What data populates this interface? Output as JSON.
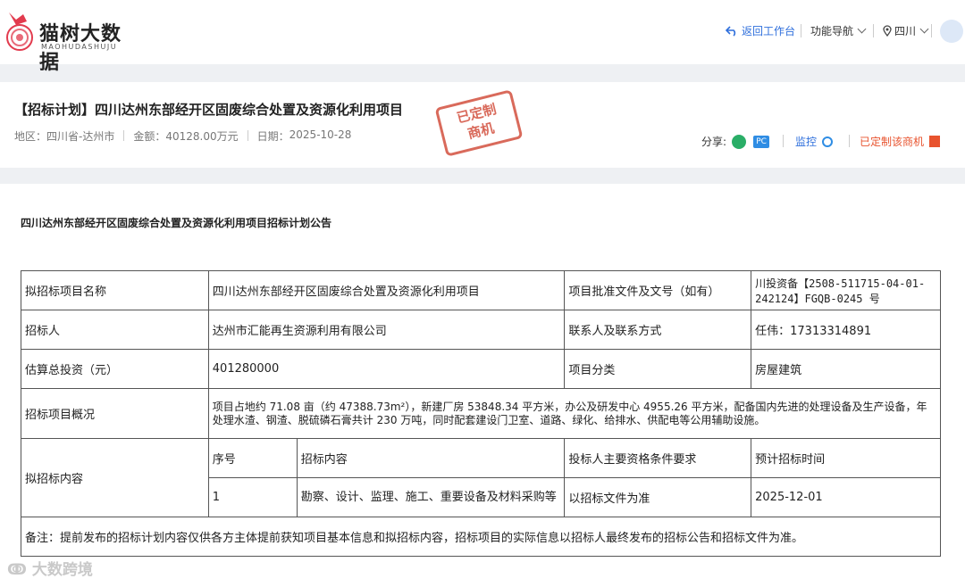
{
  "header": {
    "logo_text": "猫树大数据",
    "logo_sub": "MAOHUDASHUJU",
    "return_label": "返回工作台",
    "func_nav_label": "功能导航",
    "region_label": "四川"
  },
  "project": {
    "title": "【招标计划】四川达州东部经开区固废综合处置及资源化利用项目",
    "region_label": "地区：",
    "region_value": "四川省-达州市",
    "amount_label": "金额：",
    "amount_value": "40128.00万元",
    "date_label": "日期：",
    "date_value": "2025-10-28",
    "stamp_text_1": "已定制",
    "stamp_text_2": "商机"
  },
  "actions": {
    "share_label": "分享:",
    "pc_label": "PC",
    "monitor_label": "监控",
    "custom_label": "已定制该商机"
  },
  "notice": {
    "title": "四川达州东部经开区固废综合处置及资源化利用项目招标计划公告"
  },
  "table": {
    "r1_label": "拟招标项目名称",
    "r1_value": "四川达州东部经开区固废综合处置及资源化利用项目",
    "r1_label2": "项目批准文件及文号（如有）",
    "r1_value2": "川投资备【2508-511715-04-01-242124】FGQB-0245 号",
    "r2_label": "招标人",
    "r2_value": "达州市汇能再生资源利用有限公司",
    "r2_label2": "联系人及联系方式",
    "r2_value2": "任伟：17313314891",
    "r3_label": "估算总投资（元）",
    "r3_value": "401280000",
    "r3_label2": "项目分类",
    "r3_value2": "房屋建筑",
    "r4_label": "招标项目概况",
    "r4_value": "项目占地约 71.08 亩（约 47388.73m²），新建厂房 53848.34 平方米，办公及研发中心 4955.26 平方米，配备国内先进的处理设备及生产设备，年处理水渣、钢渣、脱硫磷石膏共计 230 万吨，同时配套建设门卫室、道路、绿化、给排水、供配电等公用辅助设施。",
    "r5_label": "拟招标内容",
    "sub_headers": [
      "序号",
      "招标内容",
      "投标人主要资格条件要求",
      "预计招标时间"
    ],
    "sub_row": [
      "1",
      "勘察、设计、监理、施工、重要设备及材料采购等",
      "以招标文件为准",
      "2025-12-01"
    ],
    "remark": "备注：提前发布的招标计划内容仅供各方主体提前获知项目基本信息和拟招标内容，招标项目的实际信息以招标人最终发布的招标公告和招标文件为准。"
  },
  "watermark": "大数跨境"
}
